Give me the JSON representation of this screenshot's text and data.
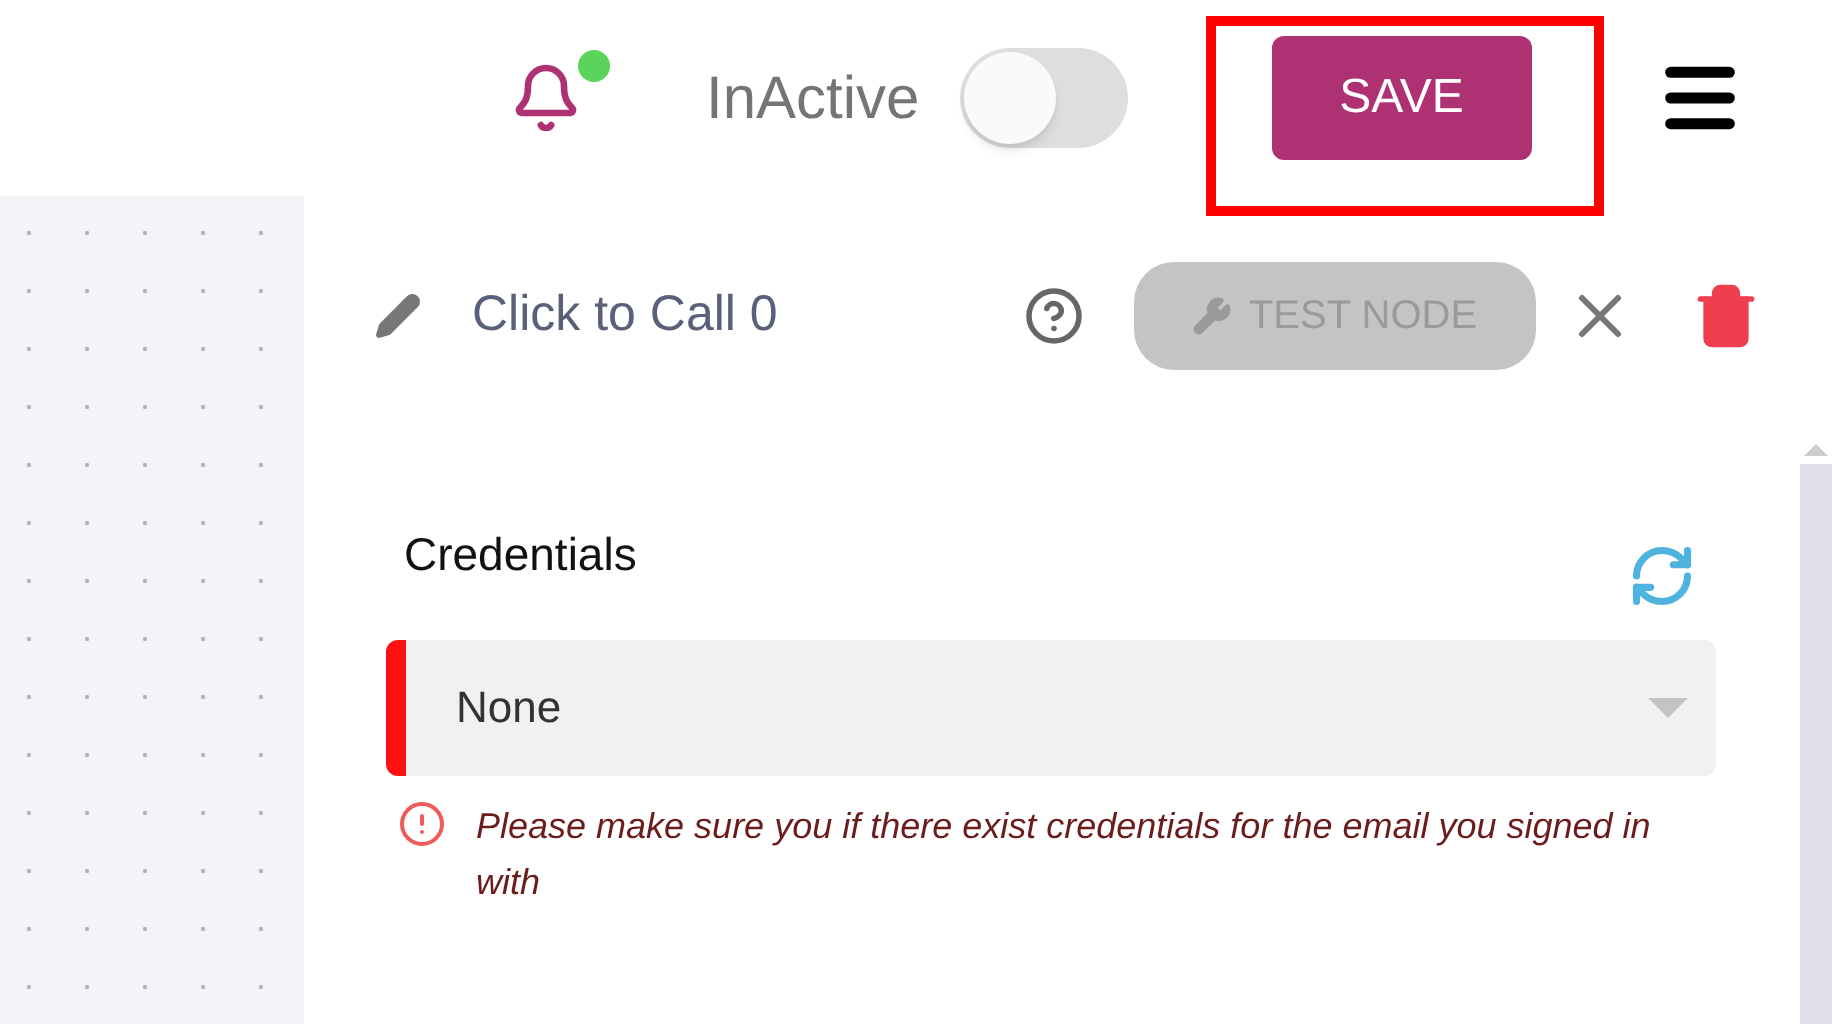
{
  "header": {
    "notifications": {
      "unread": true
    },
    "status": {
      "label": "InActive",
      "on": false
    },
    "save_button": {
      "label": "SAVE",
      "highlighted": true
    }
  },
  "node": {
    "title": "Click to Call 0",
    "test_button": {
      "label": "TEST NODE",
      "disabled": true
    }
  },
  "credentials": {
    "label": "Credentials",
    "select": {
      "value": "None",
      "error": true
    },
    "error_message": "Please make sure you if there exist credentials for the email you signed in with"
  }
}
